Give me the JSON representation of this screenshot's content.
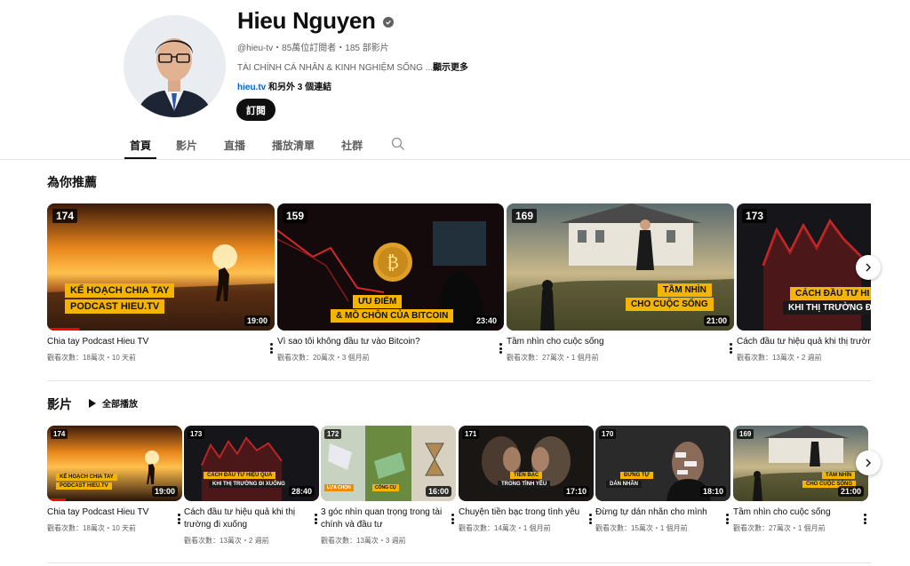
{
  "channel": {
    "name": "Hieu Nguyen",
    "handle_meta": "@hieu-tv・85萬位訂閱者・185 部影片",
    "description": "TÀI CHÍNH CÁ NHÂN & KINH NGHIỆM SỐNG ...",
    "more_label": "顯示更多",
    "link": "hieu.tv",
    "link_more": "和另外 3 個連結",
    "subscribe_label": "訂閱"
  },
  "tabs": [
    {
      "label": "首頁"
    },
    {
      "label": "影片"
    },
    {
      "label": "直播"
    },
    {
      "label": "播放清單"
    },
    {
      "label": "社群"
    }
  ],
  "recommended": {
    "title": "為你推薦",
    "videos": [
      {
        "num": "174",
        "duration": "19:00",
        "title": "Chia tay Podcast Hieu TV",
        "meta": "觀看次數：18萬次・10 天前",
        "tag1": "KẾ HOẠCH CHIA TAY",
        "tag2": "PODCAST HIEU.TV",
        "progress": 0.14
      },
      {
        "num": "159",
        "duration": "23:40",
        "title": "Vì sao tôi không đầu tư vào Bitcoin?",
        "meta": "觀看次數：20萬次・3 個月前",
        "tag1": "ƯU ĐIỂM",
        "tag2": "& MỒ CHÔN CỦA BITCOIN"
      },
      {
        "num": "169",
        "duration": "21:00",
        "title": "Tầm nhìn cho cuộc sống",
        "meta": "觀看次數：27萬次・1 個月前",
        "tag1": "TẦM NHÌN",
        "tag2": "CHO CUỘC SỐNG"
      },
      {
        "num": "173",
        "duration": "",
        "title": "Cách đầu tư hiệu quả khi thị trường đi xuống",
        "meta": "觀看次數：13萬次・2 週前",
        "tag1": "CÁCH ĐẦU TƯ HI",
        "tag2": "KHI THỊ TRƯỜNG Đ"
      }
    ]
  },
  "videos_section": {
    "title": "影片",
    "play_all": "全部播放",
    "videos": [
      {
        "num": "174",
        "duration": "19:00",
        "title": "Chia tay Podcast Hieu TV",
        "meta": "觀看次數：18萬次・10 天前",
        "tag1": "KẾ HOẠCH CHIA TAY",
        "tag2": "PODCAST HIEU.TV",
        "progress": 0.14
      },
      {
        "num": "173",
        "duration": "28:40",
        "title": "Cách đầu tư hiệu quả khi thị trường đi xuống",
        "meta": "觀看次數：13萬次・2 週前",
        "tag1": "CÁCH ĐẦU TƯ HIỆU QUẢ",
        "tag2": "KHI THỊ TRƯỜNG ĐI XUỐNG"
      },
      {
        "num": "172",
        "duration": "16:00",
        "title": "3 góc nhìn quan trọng trong tài chính và đầu tư",
        "meta": "觀看次數：13萬次・3 週前",
        "tag1": "LỰA CHỌN",
        "tag2": "CÔNG CỤ"
      },
      {
        "num": "171",
        "duration": "17:10",
        "title": "Chuyện tiền bạc trong tình yêu",
        "meta": "觀看次數：14萬次・1 個月前",
        "tag1": "TIỀN BẠC",
        "tag2": "TRONG TÌNH YÊU"
      },
      {
        "num": "170",
        "duration": "18:10",
        "title": "Đừng tự dán nhãn cho mình",
        "meta": "觀看次數：15萬次・1 個月前",
        "tag1": "ĐỪNG TỰ",
        "tag2": "DÁN NHÃN"
      },
      {
        "num": "169",
        "duration": "21:00",
        "title": "Tầm nhìn cho cuộc sống",
        "meta": "觀看次數：27萬次・1 個月前",
        "tag1": "TẦM NHÌN",
        "tag2": "CHO CUỘC SỐNG"
      }
    ]
  }
}
